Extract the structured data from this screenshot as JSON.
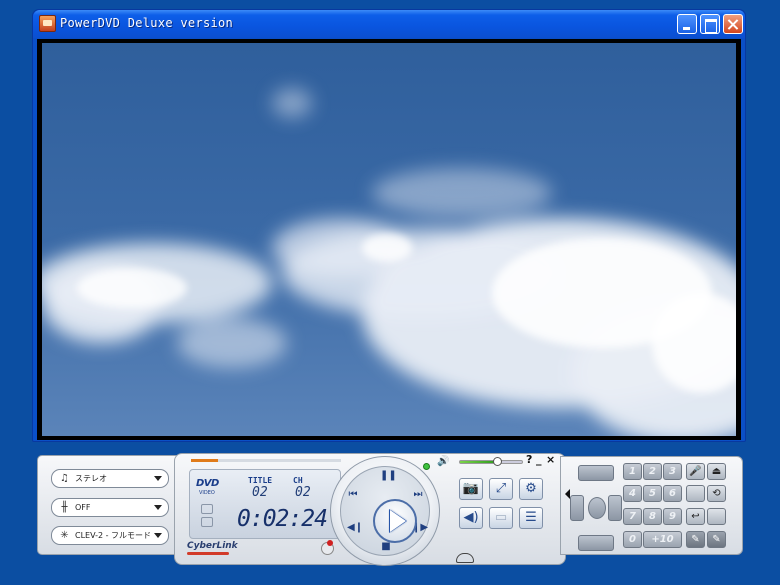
{
  "window": {
    "title": "PowerDVD Deluxe version"
  },
  "audio": {
    "channel_label": "ステレオ",
    "equalizer_label": "OFF",
    "clev_label": "CLEV-2 - フルモード"
  },
  "display": {
    "title_label": "TITLE",
    "chapter_label": "CH",
    "title_number": "02",
    "chapter_number": "02",
    "time": "0:02:24",
    "disc_type": "DVD",
    "disc_sub": "VIDEO",
    "brand": "CyberLink",
    "progress": 0.18
  },
  "volume": {
    "level": 0.58
  },
  "top_controls": {
    "help": "?",
    "minimize": "_",
    "close": "×"
  },
  "keypad": {
    "keys": [
      "1",
      "2",
      "3",
      "4",
      "5",
      "6",
      "7",
      "8",
      "9",
      "0",
      "+10"
    ]
  },
  "icons": {
    "snapshot": "camera-icon",
    "fullscreen": "fullscreen-icon",
    "settings": "tools-icon",
    "audio": "speaker-icon",
    "subtitle": "subtitle-icon",
    "playlist": "list-icon"
  },
  "colors": {
    "desktop": "#0b4ea2",
    "titlebar": "#0a55df",
    "accent": "#2a5bb0",
    "progress": "#e07b1a"
  }
}
